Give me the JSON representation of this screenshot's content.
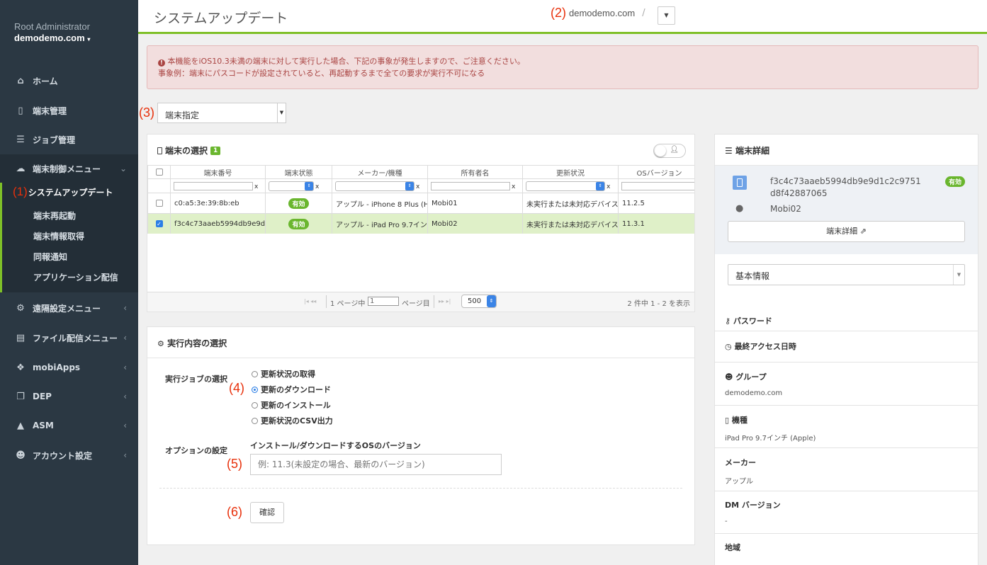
{
  "sidebar": {
    "role": "Root Administrator",
    "domain": "demodemo.com",
    "items": [
      {
        "label": "ホーム",
        "icon": "home-icon"
      },
      {
        "label": "端末管理",
        "icon": "mobile-icon"
      },
      {
        "label": "ジョブ管理",
        "icon": "server-icon"
      },
      {
        "label": "端末制御メニュー",
        "icon": "cloud-icon"
      },
      {
        "label": "遠隔設定メニュー",
        "icon": "cogs-icon"
      },
      {
        "label": "ファイル配信メニュー",
        "icon": "file-icon"
      },
      {
        "label": "mobiApps",
        "icon": "cubes-icon"
      },
      {
        "label": "DEP",
        "icon": "copy-icon"
      },
      {
        "label": "ASM",
        "icon": "graduation-cap-icon"
      },
      {
        "label": "アカウント設定",
        "icon": "users-icon"
      }
    ],
    "sub_items": [
      "システムアップデート",
      "端末再起動",
      "端末情報取得",
      "同報通知",
      "アプリケーション配信"
    ]
  },
  "annotations": {
    "a1": "(1)",
    "a2": "(2)",
    "a3": "(3)",
    "a4": "(4)",
    "a5": "(5)",
    "a6": "(6)"
  },
  "header": {
    "title": "システムアップデート",
    "domain": "demodemo.com",
    "sep": "/"
  },
  "alert": {
    "line1": "本機能をiOS10.3未満の端末に対して実行した場合、下記の事象が発生しますので、ご注意ください。",
    "line2": "事象例：端末にパスコードが設定されていると、再起動するまで全ての要求が実行不可になる"
  },
  "target_select": {
    "value": "端末指定"
  },
  "device_panel": {
    "title": "端末の選択",
    "count": "1",
    "columns": [
      "端末番号",
      "端末状態",
      "メーカー/機種",
      "所有者名",
      "更新状況",
      "OSバージョン"
    ],
    "rows": [
      {
        "id": "c0:a5:3e:39:8b:eb",
        "status": "有効",
        "model": "アップル - iPhone 8 Plus (H",
        "owner": "Mobi01",
        "update": "未実行または未対応デバイス",
        "os": "11.2.5"
      },
      {
        "id": "f3c4c73aaeb5994db9e9d",
        "status": "有効",
        "model": "アップル - iPad Pro 9.7イン",
        "owner": "Mobi02",
        "update": "未実行または未対応デバイス",
        "os": "11.3.1"
      }
    ],
    "filter_x": "x",
    "pager": {
      "page_prefix": "1 ページ中",
      "page_value": "1",
      "page_suffix": "ページ目",
      "page_size": "500",
      "summary": "2 件中 1 - 2 を表示"
    }
  },
  "exec_panel": {
    "title": "実行内容の選択",
    "job_label": "実行ジョブの選択",
    "jobs": [
      "更新状況の取得",
      "更新のダウンロード",
      "更新のインストール",
      "更新状況のCSV出力"
    ],
    "option_label": "オプションの設定",
    "version_label": "インストール/ダウンロードするOSのバージョン",
    "version_placeholder": "例: 11.3(未設定の場合、最新のバージョン)",
    "confirm": "確認"
  },
  "detail_panel": {
    "title": "端末詳細",
    "device_id_line1": "f3c4c73aaeb5994db9e9d1c2c9751",
    "device_id_line2": "d8f42887065",
    "status": "有効",
    "owner": "Mobi02",
    "detail_button": "端末詳細",
    "section_select": "基本情報",
    "password_label": "パスワード",
    "last_access_label": "最終アクセス日時",
    "group_label": "グループ",
    "group_value": "demodemo.com",
    "model_label": "機種",
    "model_value": "iPad Pro 9.7インチ (Apple)",
    "maker_label": "メーカー",
    "maker_value": "アップル",
    "dm_label": "DM バージョン",
    "dm_value": "-",
    "region_label": "地域"
  },
  "colors": {
    "sidebar": "#2b3843",
    "accent": "#7ec028",
    "annotation": "#e8300b",
    "alert_bg": "#f2dede"
  }
}
